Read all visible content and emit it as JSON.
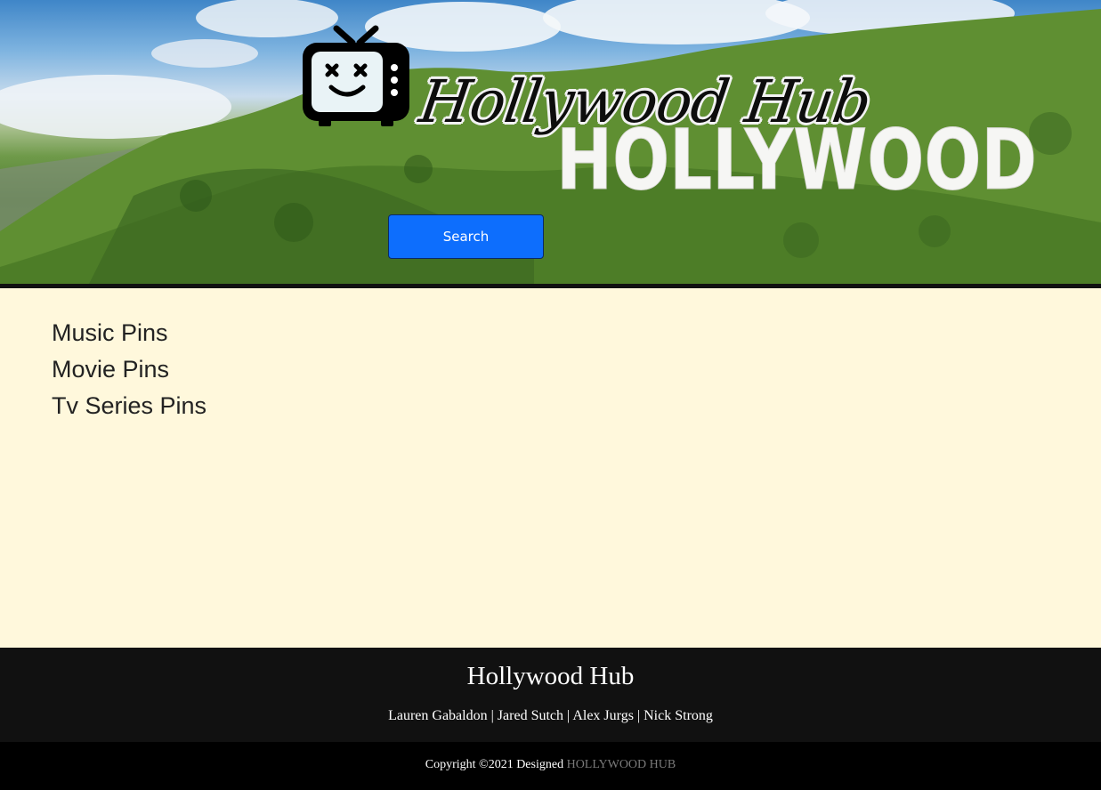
{
  "header": {
    "title": "Hollywood Hub",
    "sign_text": "HOLLYWOOD",
    "logo_icon": "tv-smiley-icon",
    "search_label": "Search"
  },
  "main": {
    "pins": [
      {
        "label": "Music Pins"
      },
      {
        "label": "Movie Pins"
      },
      {
        "label": "Tv Series Pins"
      }
    ]
  },
  "footer": {
    "title": "Hollywood Hub",
    "authors": "Lauren Gabaldon | Jared Sutch | Alex Jurgs | Nick Strong",
    "copyright_prefix": "Copyright ©2021 Designed",
    "brand": "HOLLYWOOD HUB"
  },
  "colors": {
    "accent": "#0d6efd",
    "page_background": "#fff8dc",
    "footer_background": "#111111",
    "copyright_background": "#000000",
    "brand_link": "#7a7a7a"
  }
}
